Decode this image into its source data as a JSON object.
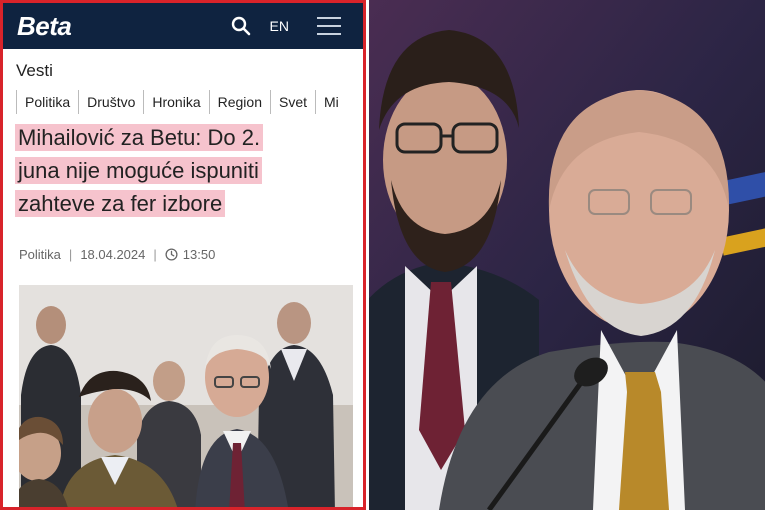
{
  "header": {
    "logo": "Beta",
    "lang": "EN"
  },
  "section": "Vesti",
  "categories": [
    "Politika",
    "Društvo",
    "Hronika",
    "Region",
    "Svet",
    "Mi"
  ],
  "article": {
    "headline_lines": [
      "Mihailović za Betu: Do 2.",
      "juna nije moguće ispuniti",
      "zahteve za fer izbore"
    ],
    "category": "Politika",
    "date": "18.04.2024",
    "time": "13:50"
  },
  "colors": {
    "topbar": "#0f2340",
    "highlight": "#f6c3cd",
    "frame_border": "#d8232a",
    "tie_gold": "#b8892a",
    "tie_maroon": "#6e2234"
  },
  "icons": [
    "search-icon",
    "menu-icon",
    "clock-icon"
  ]
}
